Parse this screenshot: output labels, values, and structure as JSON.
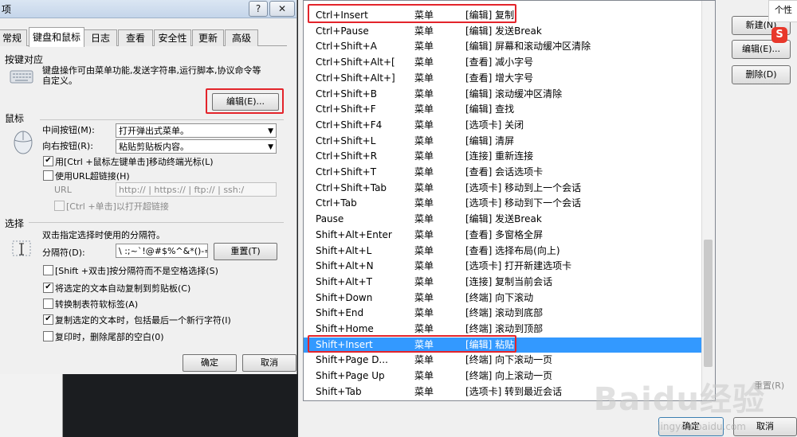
{
  "left": {
    "title_fragment": "项",
    "title_buttons": {
      "help": "?",
      "close": "✕"
    },
    "tabs": [
      {
        "label": "常规",
        "active": false
      },
      {
        "label": "键盘和鼠标",
        "active": true
      },
      {
        "label": "日志",
        "active": false
      },
      {
        "label": "查看",
        "active": false
      },
      {
        "label": "安全性",
        "active": false
      },
      {
        "label": "更新",
        "active": false
      },
      {
        "label": "高级",
        "active": false
      }
    ],
    "keymap": {
      "title": "按键对应",
      "description_line1": "键盘操作可由菜单功能,发送字符串,运行脚本,协议命令等",
      "description_line2": "自定义。",
      "edit_button": "编辑(E)..."
    },
    "mouse": {
      "title": "鼠标",
      "middle_label": "中间按钮(M):",
      "middle_value": "打开弹出式菜单。",
      "right_label": "向右按钮(R):",
      "right_value": "粘贴剪贴板内容。",
      "ctrl_click": {
        "label": "用[Ctrl +鼠标左键单击]移动终端光标(L)",
        "checked": true
      },
      "url_link": {
        "label": "使用URL超链接(H)",
        "checked": false
      },
      "url_label": "URL",
      "url_value": "http:// | https:// | ftp:// | ssh:/",
      "ctrl_url": {
        "label": "[Ctrl +单击]以打开超链接",
        "checked": false
      }
    },
    "selection": {
      "title": "选择",
      "desc": "双击指定选择时使用的分隔符。",
      "separator_label": "分隔符(D):",
      "separator_value": "\\ :;~`!@#$%^&*()-=+|",
      "reset_button": "重置(T)",
      "options": [
        {
          "label": "[Shift +双击]按分隔符而不是空格选择(S)",
          "checked": false
        },
        {
          "label": "将选定的文本自动复制到剪贴板(C)",
          "checked": true
        },
        {
          "label": "转换制表符软标签(A)",
          "checked": false
        },
        {
          "label": "复制选定的文本时，包括最后一个新行字符(I)",
          "checked": true
        },
        {
          "label": "复印时，删除尾部的空白(0)",
          "checked": false
        }
      ]
    },
    "footer": {
      "ok": "确定",
      "cancel": "取消"
    }
  },
  "right": {
    "rows": [
      {
        "key": "Ctrl+Insert",
        "type": "菜单",
        "action": "[编辑] 复制",
        "selected": false
      },
      {
        "key": "Ctrl+Pause",
        "type": "菜单",
        "action": "[编辑] 发送Break",
        "selected": false
      },
      {
        "key": "Ctrl+Shift+A",
        "type": "菜单",
        "action": "[编辑] 屏幕和滚动缓冲区清除",
        "selected": false
      },
      {
        "key": "Ctrl+Shift+Alt+[",
        "type": "菜单",
        "action": "[查看] 减小字号",
        "selected": false
      },
      {
        "key": "Ctrl+Shift+Alt+]",
        "type": "菜单",
        "action": "[查看] 增大字号",
        "selected": false
      },
      {
        "key": "Ctrl+Shift+B",
        "type": "菜单",
        "action": "[编辑] 滚动缓冲区清除",
        "selected": false
      },
      {
        "key": "Ctrl+Shift+F",
        "type": "菜单",
        "action": "[编辑] 查找",
        "selected": false
      },
      {
        "key": "Ctrl+Shift+F4",
        "type": "菜单",
        "action": "[选项卡] 关闭",
        "selected": false
      },
      {
        "key": "Ctrl+Shift+L",
        "type": "菜单",
        "action": "[编辑] 清屏",
        "selected": false
      },
      {
        "key": "Ctrl+Shift+R",
        "type": "菜单",
        "action": "[连接] 重新连接",
        "selected": false
      },
      {
        "key": "Ctrl+Shift+T",
        "type": "菜单",
        "action": "[查看] 会话选项卡",
        "selected": false
      },
      {
        "key": "Ctrl+Shift+Tab",
        "type": "菜单",
        "action": "[选项卡] 移动到上一个会话",
        "selected": false
      },
      {
        "key": "Ctrl+Tab",
        "type": "菜单",
        "action": "[选项卡] 移动到下一个会话",
        "selected": false
      },
      {
        "key": "Pause",
        "type": "菜单",
        "action": "[编辑] 发送Break",
        "selected": false
      },
      {
        "key": "Shift+Alt+Enter",
        "type": "菜单",
        "action": "[查看] 多窗格全屏",
        "selected": false
      },
      {
        "key": "Shift+Alt+L",
        "type": "菜单",
        "action": "[查看] 选择布局(向上)",
        "selected": false
      },
      {
        "key": "Shift+Alt+N",
        "type": "菜单",
        "action": "[选项卡] 打开新建选项卡",
        "selected": false
      },
      {
        "key": "Shift+Alt+T",
        "type": "菜单",
        "action": "[连接] 复制当前会话",
        "selected": false
      },
      {
        "key": "Shift+Down",
        "type": "菜单",
        "action": "[终端] 向下滚动",
        "selected": false
      },
      {
        "key": "Shift+End",
        "type": "菜单",
        "action": "[终端] 滚动到底部",
        "selected": false
      },
      {
        "key": "Shift+Home",
        "type": "菜单",
        "action": "[终端] 滚动到顶部",
        "selected": false
      },
      {
        "key": "Shift+Insert",
        "type": "菜单",
        "action": "[编辑] 粘贴",
        "selected": true
      },
      {
        "key": "Shift+Page D...",
        "type": "菜单",
        "action": "[终端] 向下滚动一页",
        "selected": false
      },
      {
        "key": "Shift+Page Up",
        "type": "菜单",
        "action": "[终端] 向上滚动一页",
        "selected": false
      },
      {
        "key": "Shift+Tab",
        "type": "菜单",
        "action": "[选项卡] 转到最近会话",
        "selected": false
      }
    ],
    "side_buttons": {
      "new": "新建(N)",
      "edit": "编辑(E)...",
      "delete": "删除(D)",
      "reset": "重置(R)"
    },
    "tooltip_fragment": "个性",
    "footer": {
      "ok": "确定",
      "cancel": "取消"
    },
    "watermark": "Baidu经验",
    "watermark_sub": "jingyan.baidu.com"
  },
  "colors": {
    "highlight": "#e3242b",
    "selection": "#3399ff"
  }
}
